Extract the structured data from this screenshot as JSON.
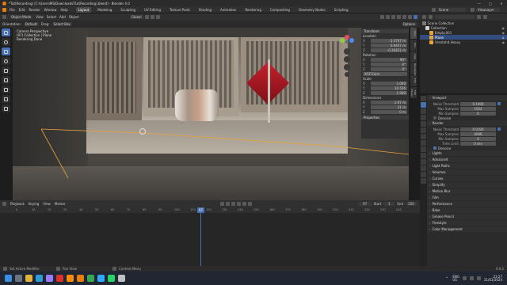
{
  "window": {
    "title": "*Tut(Recording) [C:\\Users\\MS\\Downloads\\Tut(Recording).blend] - Blender 4.0",
    "controls": [
      "—",
      "□",
      "✕"
    ]
  },
  "menu": {
    "items": [
      "File",
      "Edit",
      "Render",
      "Window",
      "Help"
    ],
    "workspaces": [
      "Layout",
      "Modeling",
      "Sculpting",
      "UV Editing",
      "Texture Paint",
      "Shading",
      "Animation",
      "Rendering",
      "Compositing",
      "Geometry Nodes",
      "Scripting"
    ],
    "active_workspace": "Layout",
    "scene_label": "Scene",
    "view_layer_label": "ViewLayer"
  },
  "viewport_header": {
    "mode": "Object Mode",
    "items": [
      "View",
      "Select",
      "Add",
      "Object"
    ],
    "orientation_label": "Orientation:",
    "orientation": "Default",
    "drag_label": "Drag:",
    "drag": "Select Box",
    "transform": "Global",
    "options": "Options"
  },
  "overlay_text": {
    "line1": "Camera Perspective",
    "line2": "(97) Collection | Plane",
    "line3": "Rendering Done"
  },
  "n_panel": {
    "transform_title": "Transform",
    "location_label": "Location",
    "location": [
      {
        "k": "X",
        "v": "-1.3747 m"
      },
      {
        "k": "Y",
        "v": "0.9437 m"
      },
      {
        "k": "Z",
        "v": "-0.26421 m"
      }
    ],
    "rotation_label": "Rotation",
    "rotation": [
      {
        "k": "X",
        "v": "90°"
      },
      {
        "k": "Y",
        "v": "0°"
      },
      {
        "k": "Z",
        "v": "0°"
      }
    ],
    "euler_label": "XYZ Euler",
    "scale_label": "Scale",
    "scale": [
      {
        "k": "X",
        "v": "1.000"
      },
      {
        "k": "Y",
        "v": "10.526"
      },
      {
        "k": "Z",
        "v": "1.000"
      }
    ],
    "dimensions_label": "Dimensions",
    "dimensions": [
      {
        "k": "X",
        "v": "2.97 m"
      },
      {
        "k": "Y",
        "v": "21 m"
      },
      {
        "k": "Z",
        "v": "0 m"
      }
    ],
    "properties_label": "Properties",
    "tabs": [
      "Item",
      "Tool",
      "View",
      "BlenderKit",
      "Edit",
      "FLIP Fluids"
    ]
  },
  "timeline": {
    "playback": "Playback",
    "keying": "Keying",
    "view": "View",
    "marker": "Marker",
    "current_frame": "97",
    "start_label": "Start",
    "start": "1",
    "end_label": "End",
    "end": "250",
    "ticks": [
      "0",
      "10",
      "20",
      "30",
      "40",
      "50",
      "60",
      "70",
      "80",
      "90",
      "100",
      "110",
      "120",
      "130",
      "140",
      "150",
      "160",
      "170",
      "180",
      "190",
      "200",
      "210",
      "220",
      "230",
      "240"
    ]
  },
  "outliner": {
    "search_placeholder": "",
    "rows": [
      {
        "label": "Scene Collection",
        "indent": 0,
        "selected": false
      },
      {
        "label": "Collection",
        "indent": 1,
        "selected": false
      },
      {
        "label": "Empty.001",
        "indent": 2,
        "selected": false
      },
      {
        "label": "Plane",
        "indent": 2,
        "selected": true
      },
      {
        "label": "Vrentah4.Heavy",
        "indent": 2,
        "selected": false
      }
    ]
  },
  "properties": {
    "sections": [
      {
        "type": "head",
        "label": "Viewport"
      },
      {
        "type": "field",
        "label": "Noise Threshold",
        "value": "0.1000",
        "check": true
      },
      {
        "type": "field",
        "label": "Max Samples",
        "value": "1024"
      },
      {
        "type": "field",
        "label": "Min Samples",
        "value": "0"
      },
      {
        "type": "sub",
        "label": "Denoise",
        "check": false
      },
      {
        "type": "head",
        "label": "Render"
      },
      {
        "type": "field",
        "label": "Noise Threshold",
        "value": "0.0100",
        "check": true
      },
      {
        "type": "field",
        "label": "Max Samples",
        "value": "4096"
      },
      {
        "type": "field",
        "label": "Min Samples",
        "value": "0"
      },
      {
        "type": "field",
        "label": "Time Limit",
        "value": "0 sec"
      },
      {
        "type": "sub",
        "label": "Denoise",
        "check": true
      },
      {
        "type": "head",
        "label": "Lights"
      },
      {
        "type": "head",
        "label": "Advanced"
      },
      {
        "type": "head",
        "label": "Light Paths"
      },
      {
        "type": "head",
        "label": "Volumes"
      },
      {
        "type": "head",
        "label": "Curves"
      },
      {
        "type": "head",
        "label": "Simplify"
      },
      {
        "type": "head",
        "label": "Motion Blur"
      },
      {
        "type": "head",
        "label": "Film"
      },
      {
        "type": "head",
        "label": "Performance"
      },
      {
        "type": "head",
        "label": "Bake"
      },
      {
        "type": "head",
        "label": "Grease Pencil"
      },
      {
        "type": "head",
        "label": "Freestyle"
      },
      {
        "type": "head",
        "label": "Color Management"
      }
    ]
  },
  "statusbar": {
    "left": "Set Active Modifier",
    "middle": "Pan View",
    "right": "Context Menu",
    "version": "4.0.2"
  },
  "taskbar": {
    "apps": [
      {
        "name": "start",
        "color": "#3a8ee6"
      },
      {
        "name": "search",
        "color": "#6b7380"
      },
      {
        "name": "explorer",
        "color": "#e2b33c"
      },
      {
        "name": "edge",
        "color": "#2a9cd3"
      },
      {
        "name": "premiere",
        "color": "#9a7bff"
      },
      {
        "name": "acrobat",
        "color": "#d9302b"
      },
      {
        "name": "illustrator",
        "color": "#ff8a00"
      },
      {
        "name": "blender",
        "color": "#e87d0d"
      },
      {
        "name": "chrome",
        "color": "#34a853"
      },
      {
        "name": "photoshop",
        "color": "#31a8ff"
      },
      {
        "name": "whatsapp",
        "color": "#25d366"
      },
      {
        "name": "camera",
        "color": "#c0c0c0"
      }
    ],
    "lang": "ENG",
    "region": "US",
    "time": "23:27",
    "date": "21/01/2024"
  },
  "colors": {
    "accent": "#4772b3",
    "cube": "#c4202c",
    "selection": "#e8a33a"
  }
}
